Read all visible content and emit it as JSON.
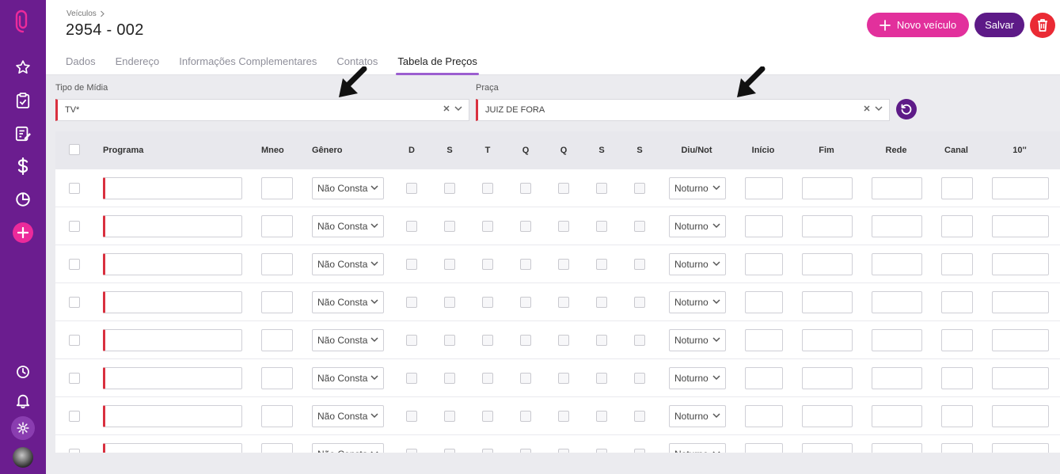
{
  "header": {
    "breadcrumb": "Veículos",
    "title": "2954 - 002",
    "tabs": [
      {
        "label": "Dados",
        "active": false
      },
      {
        "label": "Endereço",
        "active": false
      },
      {
        "label": "Informações Complementares",
        "active": false
      },
      {
        "label": "Contatos",
        "active": false
      },
      {
        "label": "Tabela de Preços",
        "active": true
      }
    ],
    "buttons": {
      "novo": "Novo veículo",
      "salvar": "Salvar"
    }
  },
  "filters": {
    "tipo_midia": {
      "label": "Tipo de Mídia",
      "value": "TV*"
    },
    "praca": {
      "label": "Praça",
      "value": "JUIZ DE FORA"
    }
  },
  "table": {
    "columns": [
      "Programa",
      "Mneo",
      "Gênero",
      "D",
      "S",
      "T",
      "Q",
      "Q",
      "S",
      "S",
      "Diu/Not",
      "Início",
      "Fim",
      "Rede",
      "Canal",
      "10''"
    ],
    "rows": [
      {
        "genero": "Não Consta",
        "diu_not": "Noturno"
      },
      {
        "genero": "Não Consta",
        "diu_not": "Noturno"
      },
      {
        "genero": "Não Consta",
        "diu_not": "Noturno"
      },
      {
        "genero": "Não Consta",
        "diu_not": "Noturno"
      },
      {
        "genero": "Não Consta",
        "diu_not": "Noturno"
      },
      {
        "genero": "Não Consta",
        "diu_not": "Noturno"
      },
      {
        "genero": "Não Consta",
        "diu_not": "Noturno"
      },
      {
        "genero": "Não Consta",
        "diu_not": "Noturno"
      }
    ]
  },
  "colors": {
    "sidebar": "#6b1d8f",
    "accent_pink": "#e2309c",
    "accent_purple": "#5d1a87",
    "danger": "#ea2a34",
    "required": "#d9303f",
    "tab_underline": "#9b5ed0"
  },
  "icons": {
    "sidebar": [
      "paperclip-logo-icon",
      "star-icon",
      "clipboard-check-icon",
      "edit-note-icon",
      "dollar-icon",
      "pie-chart-icon",
      "plus-icon",
      "clock-icon",
      "bell-icon",
      "gear-icon"
    ]
  }
}
